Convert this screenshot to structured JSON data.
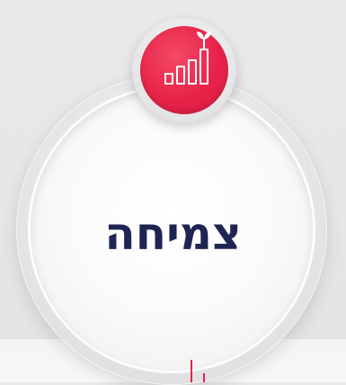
{
  "title": "צמיחה",
  "badge": {
    "icon": "growth-chart-icon",
    "color": "#e8234a",
    "icon_color": "#ffffff"
  },
  "title_color": "#1f2552",
  "accent_color": "#e8234a"
}
